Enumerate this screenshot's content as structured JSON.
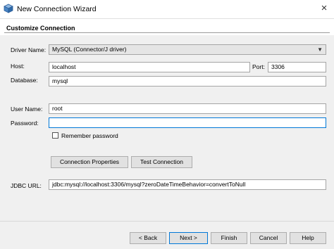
{
  "window": {
    "title": "New Connection Wizard",
    "close_glyph": "×",
    "app_icon": "netbeans-cube-icon"
  },
  "header": {
    "title": "Customize Connection"
  },
  "form": {
    "driver_label": "Driver Name:",
    "driver_value": "MySQL (Connector/J driver)",
    "host_label": "Host:",
    "host_value": "localhost",
    "port_label": "Port:",
    "port_value": "3306",
    "database_label": "Database:",
    "database_value": "mysql",
    "username_label": "User Name:",
    "username_value": "root",
    "password_label": "Password:",
    "password_value": "",
    "remember_label": "Remember password",
    "remember_checked": false,
    "conn_props_label": "Connection Properties",
    "test_conn_label": "Test Connection",
    "jdbc_label": "JDBC URL:",
    "jdbc_value": "jdbc:mysql://localhost:3306/mysql?zeroDateTimeBehavior=convertToNull"
  },
  "footer": {
    "back_label": "< Back",
    "next_label": "Next >",
    "finish_label": "Finish",
    "cancel_label": "Cancel",
    "help_label": "Help"
  },
  "colors": {
    "panel_bg": "#f0f0f0",
    "focus_border": "#0078d7"
  }
}
